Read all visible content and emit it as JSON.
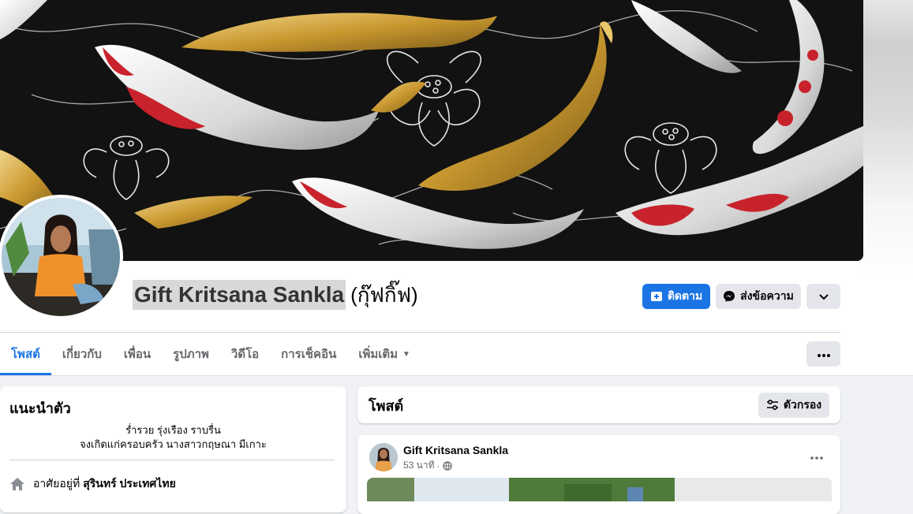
{
  "profile": {
    "name": "Gift Kritsana Sankla",
    "alt_name": "(กุ๊ฟกิ๊ฟ)"
  },
  "actions": {
    "follow_label": "ติดตาม",
    "message_label": "ส่งข้อความ"
  },
  "tabs": [
    {
      "label": "โพสต์",
      "active": true
    },
    {
      "label": "เกี่ยวกับ"
    },
    {
      "label": "เพื่อน"
    },
    {
      "label": "รูปภาพ"
    },
    {
      "label": "วิดีโอ"
    },
    {
      "label": "การเช็คอิน"
    },
    {
      "label": "เพิ่มเติม"
    }
  ],
  "intro": {
    "title": "แนะนำตัว",
    "bio_line1": "ร่ำรวย รุ่งเรือง ราบรื่น",
    "bio_line2": "จงเกิดแก่ครอบครัว นางสาวกฤษณา มีเกาะ",
    "lives_in_prefix": "อาศัยอยู่ที่",
    "lives_in_place": "สุรินทร์ ประเทศไทย"
  },
  "posts": {
    "title": "โพสต์",
    "filter_label": "ตัวกรอง",
    "first_post": {
      "author": "Gift Kritsana Sankla",
      "time": "53 นาที"
    }
  },
  "colors": {
    "accent": "#1b74e4",
    "background": "#f0f2f5",
    "secondary_text": "#65676b",
    "button_grey": "#e4e6eb"
  },
  "icons": {
    "follow": "follow-icon",
    "message": "messenger-icon",
    "more": "chevron-down-icon",
    "tab_more": "ellipsis-icon",
    "filter": "filter-icon",
    "home": "home-icon",
    "privacy": "globe-icon"
  }
}
